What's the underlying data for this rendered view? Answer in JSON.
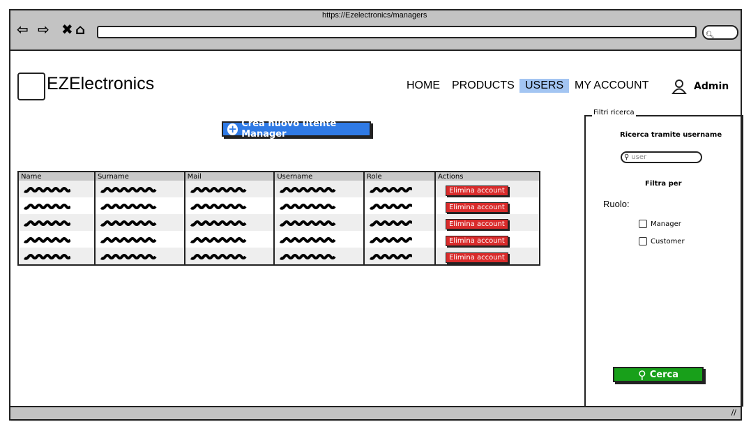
{
  "browser": {
    "url": "https://Ezelectronics/managers"
  },
  "header": {
    "logo": "EZElectronics",
    "menu": [
      "HOME",
      "PRODUCTS",
      "USERS",
      "MY ACCOUNT"
    ],
    "active": "USERS",
    "user": "Admin"
  },
  "main": {
    "create_button": "Crea nuovo utente Manager",
    "table": {
      "columns": [
        "Name",
        "Surname",
        "Mail",
        "Username",
        "Role",
        "Actions"
      ],
      "row_count": 5,
      "action_label": "Elimina account"
    }
  },
  "filters": {
    "title": "Filtri ricerca",
    "search_heading": "Ricerca tramite username",
    "search_placeholder": "user",
    "filter_heading": "Filtra per",
    "role_label": "Ruolo:",
    "options": [
      "Manager",
      "Customer"
    ],
    "search_button": "Cerca"
  },
  "colors": {
    "primary": "#2f7ae5",
    "danger": "#d92b2b",
    "success": "#18a01a",
    "active_tab": "#a3c5f2"
  }
}
